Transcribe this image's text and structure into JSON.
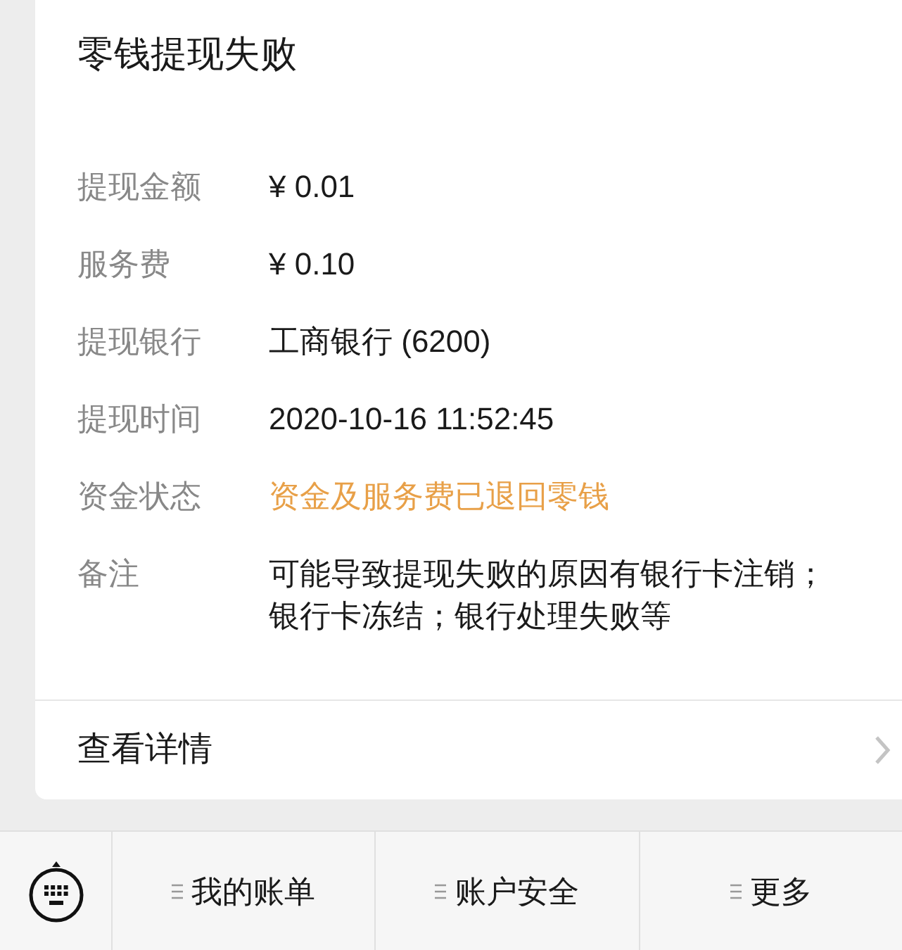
{
  "title": "零钱提现失败",
  "details": [
    {
      "label": "提现金额",
      "value": "¥ 0.01",
      "kind": "plain"
    },
    {
      "label": "服务费",
      "value": "¥ 0.10",
      "kind": "plain"
    },
    {
      "label": "提现银行",
      "value": "工商银行 (6200)",
      "kind": "plain"
    },
    {
      "label": "提现时间",
      "value": "2020-10-16 11:52:45",
      "kind": "plain"
    },
    {
      "label": "资金状态",
      "value": "资金及服务费已退回零钱",
      "kind": "status"
    },
    {
      "label": "备注",
      "value": "可能导致提现失败的原因有银行卡注销；银行卡冻结；银行处理失败等",
      "kind": "plain"
    }
  ],
  "detail_link": "查看详情",
  "menu": [
    "我的账单",
    "账户安全",
    "更多"
  ]
}
